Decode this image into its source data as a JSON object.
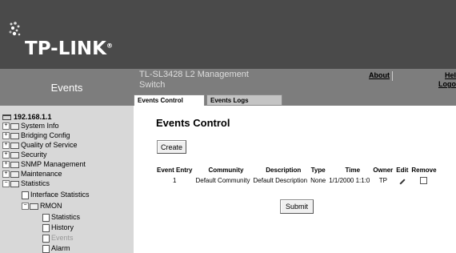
{
  "brand": {
    "logo_text": "TP-LINK",
    "logo_registered": "®"
  },
  "left_header": {
    "title": "Events"
  },
  "app": {
    "title": "TL-SL3428 L2 Management Switch"
  },
  "top_links": {
    "about": "About",
    "help": "Hel",
    "logout": "Logo"
  },
  "tabs": [
    {
      "label": "Events Control",
      "active": true
    },
    {
      "label": "Events Logs",
      "active": false
    }
  ],
  "nav": {
    "root": "192.168.1.1",
    "items": [
      {
        "label": "System Info",
        "expander": "+"
      },
      {
        "label": "Bridging Config",
        "expander": "+"
      },
      {
        "label": "Quality of Service",
        "expander": "+"
      },
      {
        "label": "Security",
        "expander": "+"
      },
      {
        "label": "SNMP Management",
        "expander": "+"
      },
      {
        "label": "Maintenance",
        "expander": "+"
      },
      {
        "label": "Statistics",
        "expander": "−"
      },
      {
        "label": "Interface Statistics"
      },
      {
        "label": "RMON",
        "expander": "−"
      },
      {
        "label": "Statistics"
      },
      {
        "label": "History"
      },
      {
        "label": "Events",
        "selected": true
      },
      {
        "label": "Alarm"
      }
    ]
  },
  "main": {
    "title": "Events Control",
    "create_label": "Create",
    "submit_label": "Submit",
    "table": {
      "headers": [
        "Event Entry",
        "Community",
        "Description",
        "Type",
        "Time",
        "Owner",
        "Edit",
        "Remove"
      ],
      "rows": [
        [
          "1",
          "Default Community",
          "Default Description",
          "None",
          "1/1/2000 1:1:0",
          "TP"
        ]
      ]
    }
  },
  "colors": {
    "banner": "#4a4a4a",
    "header_gray": "#7d7d7d",
    "nav_bg": "#d8d8d8"
  }
}
